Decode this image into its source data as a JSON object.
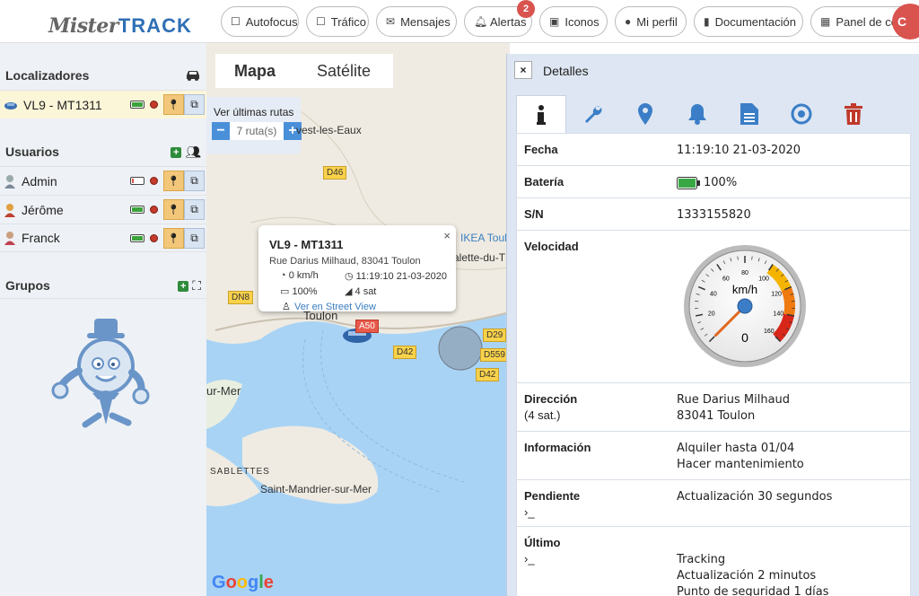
{
  "logo": {
    "text_a": "Mister",
    "text_b": "TRACK"
  },
  "nav": [
    {
      "label": "Autofocus",
      "icon": "square-icon"
    },
    {
      "label": "Tráfico",
      "icon": "square-icon"
    },
    {
      "label": "Mensajes",
      "icon": "envelope-icon"
    },
    {
      "label": "Alertas",
      "icon": "bell-icon",
      "badge": "2"
    },
    {
      "label": "Iconos",
      "icon": "image-icon"
    },
    {
      "label": "Mi perfil",
      "icon": "user-icon"
    },
    {
      "label": "Documentación",
      "icon": "book-icon"
    },
    {
      "label": "Panel de contr",
      "icon": "table-icon"
    }
  ],
  "nav_extra_circle": "C",
  "sidebar": {
    "localizadores_title": "Localizadores",
    "usuarios_title": "Usuarios",
    "grupos_title": "Grupos",
    "trackers": [
      {
        "name": "VL9 - MT1311",
        "battery": 1.0
      }
    ],
    "users": [
      {
        "name": "Admin",
        "battery": 0.15
      },
      {
        "name": "Jérôme",
        "battery": 1.0
      },
      {
        "name": "Franck",
        "battery": 1.0
      }
    ]
  },
  "map": {
    "tab_map": "Mapa",
    "tab_sat": "Satélite",
    "routes_label": "Ver últimas rutas",
    "routes_value": "7 ruta(s)",
    "routes_minus": "−",
    "routes_plus": "+",
    "places": [
      {
        "label": "vest-les-Eaux",
        "cls": "p1"
      },
      {
        "label": "IKEA Toul",
        "cls": "p2"
      },
      {
        "label": "alette-du-T",
        "cls": "p3"
      },
      {
        "label": "Toulon",
        "cls": "p4"
      },
      {
        "label": "ur-Mer",
        "cls": "p5"
      },
      {
        "label": "SABLETTES",
        "cls": "p6"
      },
      {
        "label": "Saint-Mandrier-sur-Mer",
        "cls": "p7"
      }
    ],
    "roads": [
      {
        "label": "D46",
        "cls": "r1"
      },
      {
        "label": "DN8",
        "cls": "r2"
      },
      {
        "label": "A50",
        "cls": "r3"
      },
      {
        "label": "D42",
        "cls": "r4"
      },
      {
        "label": "D29",
        "cls": "r5"
      },
      {
        "label": "D559",
        "cls": "r6"
      },
      {
        "label": "D42",
        "cls": "r7"
      }
    ],
    "popup": {
      "title": "VL9 - MT1311",
      "address": "Rue Darius Milhaud, 83041 Toulon",
      "speed": "0 km/h",
      "time": "11:19:10 21-03-2020",
      "battery": "100%",
      "sats": "4 sat",
      "streetview": "Ver en Street View",
      "close": "×"
    },
    "google": {
      "g1": "G",
      "g2": "o",
      "g3": "o",
      "g4": "g",
      "g5": "l",
      "g6": "e"
    }
  },
  "details": {
    "title": "Detalles",
    "close": "×",
    "tabs": [
      "info-icon",
      "wrench-icon",
      "map-marker-icon",
      "bell-icon",
      "file-icon",
      "target-icon",
      "trash-icon"
    ],
    "rows": {
      "fecha": {
        "key": "Fecha",
        "value": "11:19:10 21-03-2020"
      },
      "bateria": {
        "key": "Batería",
        "value": "100%"
      },
      "sn": {
        "key": "S/N",
        "value": "1333155820"
      },
      "velocidad": {
        "key": "Velocidad",
        "gauge_unit": "km/h",
        "gauge_value": 0,
        "gauge_max": 160,
        "gauge_ticks": [
          "0",
          "20",
          "40",
          "60",
          "80",
          "100",
          "120",
          "140",
          "160"
        ]
      },
      "direccion": {
        "key": "Dirección",
        "sub": "(4 sat.)",
        "line1": "Rue Darius Milhaud",
        "line2": "83041 Toulon"
      },
      "informacion": {
        "key": "Información",
        "line1": "Alquiler hasta 01/04",
        "line2": "Hacer mantenimiento"
      },
      "pendiente": {
        "key": "Pendiente",
        "sub": "›_",
        "line1": "Actualización 30 segundos"
      },
      "ultimo": {
        "key": "Último",
        "sub": "›_",
        "line1": "Tracking",
        "line2": "Actualización 2 minutos",
        "line3": "Punto de seguridad 1 días"
      }
    }
  }
}
